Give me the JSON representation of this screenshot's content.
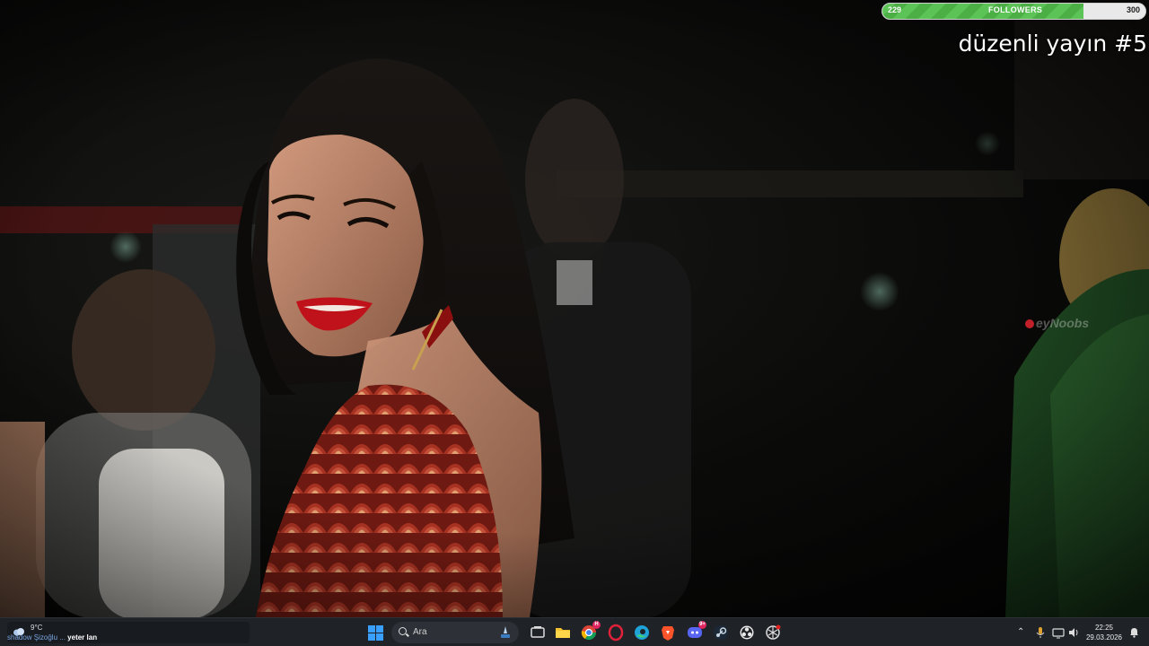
{
  "overlay": {
    "follower_goal": {
      "current": "229",
      "title": "FOLLOWERS",
      "target": "300",
      "progress_fraction": 0.763
    },
    "stream_title": "düzenli yayın #5",
    "watermark": "eyNoobs"
  },
  "taskbar": {
    "weather": {
      "temperature": "9°C",
      "ticker_prefix": "shadow Şizoğlu ...",
      "ticker_message": "yeter lan"
    },
    "search": {
      "placeholder": "Ara"
    },
    "apps": [
      {
        "name": "task-view-icon"
      },
      {
        "name": "file-explorer-icon"
      },
      {
        "name": "chrome-icon",
        "badge": "H"
      },
      {
        "name": "opera-gx-icon"
      },
      {
        "name": "edge-icon"
      },
      {
        "name": "brave-icon"
      },
      {
        "name": "discord-icon",
        "badge": "9+"
      },
      {
        "name": "steam-icon"
      },
      {
        "name": "obs-icon"
      },
      {
        "name": "chatgpt-icon"
      }
    ],
    "clock": {
      "time": "22:25",
      "date": "29.03.2026"
    }
  },
  "colors": {
    "taskbar_bg": "#1f2227",
    "goal_fill": "#4caf46",
    "accent_blue": "#3aa0ff"
  }
}
